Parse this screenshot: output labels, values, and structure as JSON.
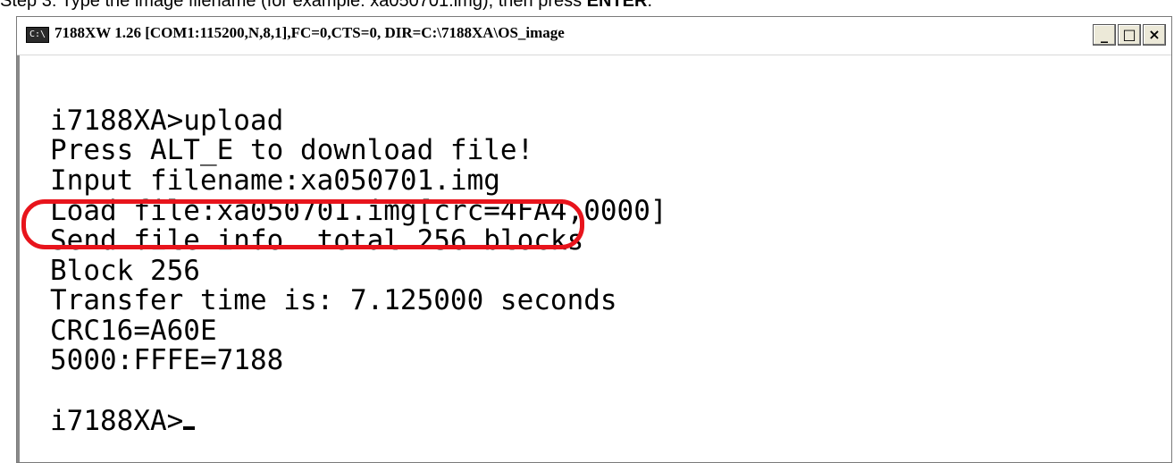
{
  "caption": {
    "prefix": "Step 3: Type the image filename (for example: xa050701.img), then press ",
    "key": "ENTER",
    "suffix": "."
  },
  "window": {
    "title": "7188XW 1.26 [COM1:115200,N,8,1],FC=0,CTS=0, DIR=C:\\7188XA\\OS_image",
    "icon": "console-icon",
    "icon_glyph": "C:\\",
    "buttons": {
      "minimize": "_",
      "maximize": "□",
      "close": "×"
    }
  },
  "console": {
    "lines": [
      "i7188XA>upload",
      "Press ALT_E to download file!",
      "Input filename:xa050701.img",
      "Load file:xa050701.img[crc=4FA4,0000]",
      "Send file info. total 256 blocks",
      "Block 256",
      "Transfer time is: 7.125000 seconds",
      "CRC16=A60E",
      "5000:FFFE=7188",
      "",
      "i7188XA>"
    ]
  },
  "colors": {
    "highlight": "#e8141c"
  }
}
